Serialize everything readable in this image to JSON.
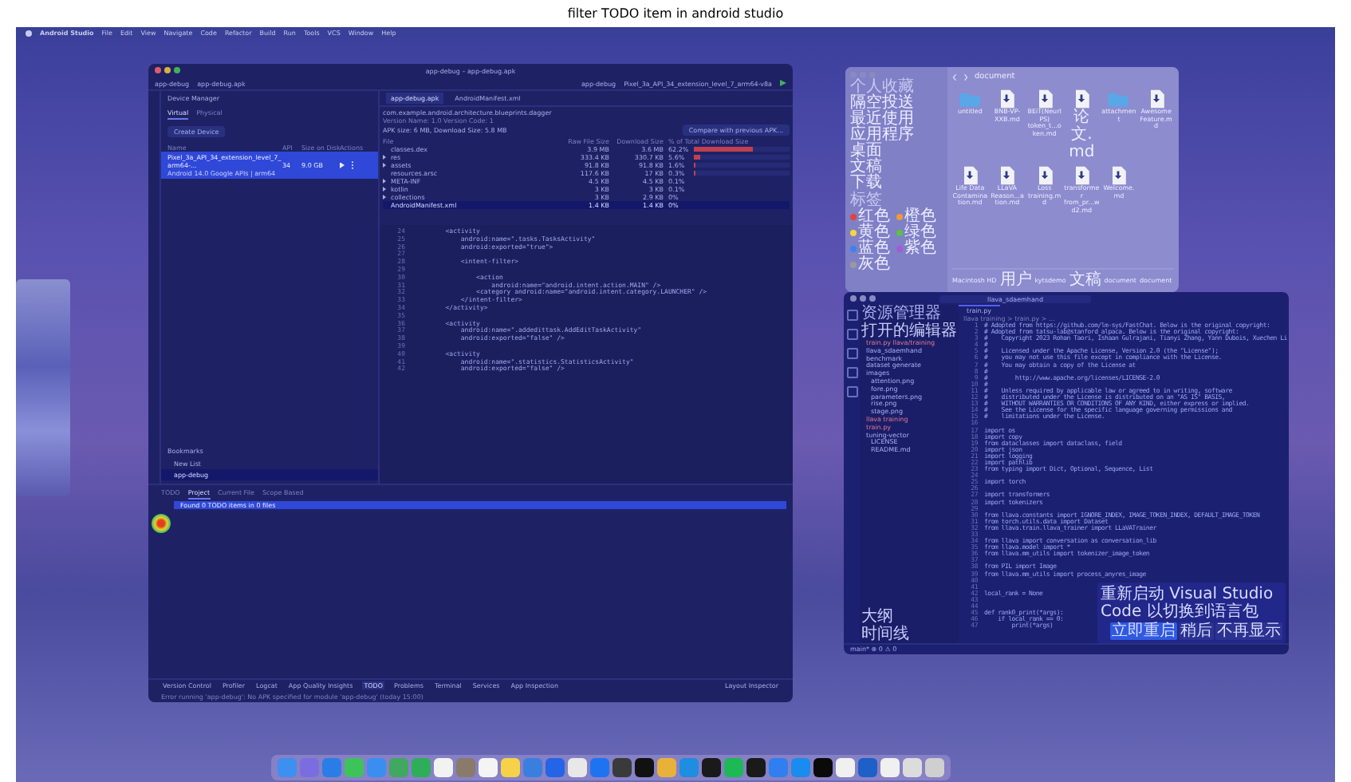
{
  "title": "filter TODO item in android studio",
  "menubar": {
    "app": "Android Studio",
    "items": [
      "File",
      "Edit",
      "View",
      "Navigate",
      "Code",
      "Refactor",
      "Build",
      "Run",
      "Tools",
      "VCS",
      "Window",
      "Help"
    ]
  },
  "android_studio": {
    "title": "app-debug – app-debug.apk",
    "project": "app-debug",
    "breadcrumb": "app-debug.apk",
    "run_config": "app-debug",
    "device": "Pixel_3a_API_34_extension_level_7_arm64-v8a",
    "device_manager": {
      "title": "Device Manager",
      "tabs": [
        {
          "label": "Virtual",
          "selected": true
        },
        {
          "label": "Physical",
          "selected": false
        }
      ],
      "create_button": "Create Device",
      "columns": [
        "Name",
        "API",
        "Size on Disk",
        "Actions"
      ],
      "devices": [
        {
          "name": "Pixel_3a_API_34_extension_level_7_arm64-...",
          "subtitle": "Android 14.0 Google APIs | arm64",
          "api": "34",
          "size": "9.0 GB",
          "selected": true
        }
      ]
    },
    "bookmarks": {
      "title": "Bookmarks",
      "items": [
        {
          "label": "New List",
          "selected": false
        },
        {
          "label": "app-debug",
          "selected": true
        }
      ]
    },
    "editor_tabs": [
      {
        "label": "app-debug.apk",
        "selected": true
      },
      {
        "label": "AndroidManifest.xml",
        "selected": false
      }
    ],
    "apk": {
      "package": "com.example.android.architecture.blueprints.dagger",
      "version": "Version Name: 1.0  Version Code: 1",
      "size_line": "APK size: 6 MB, Download Size: 5.8 MB",
      "compare_button": "Compare with previous APK...",
      "columns": [
        "File",
        "Raw File Size",
        "Download Size",
        "% of Total Download Size"
      ],
      "rows": [
        {
          "name": "classes.dex",
          "raw": "3.9 MB",
          "download": "3.6 MB",
          "percent": "62.2%",
          "level": 0.62,
          "expandable": false,
          "selected": false
        },
        {
          "name": "res",
          "raw": "333.4 KB",
          "download": "330.7 KB",
          "percent": "5.6%",
          "level": 0.06,
          "expandable": true,
          "selected": false
        },
        {
          "name": "assets",
          "raw": "91.8 KB",
          "download": "91.8 KB",
          "percent": "1.6%",
          "level": 0.02,
          "expandable": true,
          "selected": false
        },
        {
          "name": "resources.arsc",
          "raw": "117.6 KB",
          "download": "17 KB",
          "percent": "0.3%",
          "level": 0.01,
          "expandable": false,
          "selected": false
        },
        {
          "name": "META-INF",
          "raw": "4.5 KB",
          "download": "4.5 KB",
          "percent": "0.1%",
          "expandable": true,
          "selected": false
        },
        {
          "name": "kotlin",
          "raw": "3 KB",
          "download": "3 KB",
          "percent": "0.1%",
          "expandable": true,
          "selected": false
        },
        {
          "name": "collections",
          "raw": "3 KB",
          "download": "2.9 KB",
          "percent": "0%",
          "expandable": true,
          "selected": false
        },
        {
          "name": "AndroidManifest.xml",
          "raw": "1.4 KB",
          "download": "1.4 KB",
          "percent": "0%",
          "expandable": false,
          "selected": true
        }
      ]
    },
    "code": [
      {
        "n": "24",
        "text": "        <activity"
      },
      {
        "n": "25",
        "text": "            android:name=\".tasks.TasksActivity\""
      },
      {
        "n": "26",
        "text": "            android:exported=\"true\">"
      },
      {
        "n": "27"
      },
      {
        "n": "28",
        "text": "            <intent-filter>"
      },
      {
        "n": "29"
      },
      {
        "n": "30",
        "text": "                <action"
      },
      {
        "n": "31",
        "text": "                    android:name=\"android.intent.action.MAIN\" />"
      },
      {
        "n": "32",
        "text": "                <category android:name=\"android.intent.category.LAUNCHER\" />"
      },
      {
        "n": "33",
        "text": "            </intent-filter>"
      },
      {
        "n": "34",
        "text": "        </activity>"
      },
      {
        "n": "35"
      },
      {
        "n": "36",
        "text": "        <activity"
      },
      {
        "n": "37",
        "text": "            android:name=\".addedittask.AddEditTaskActivity\""
      },
      {
        "n": "38",
        "text": "            android:exported=\"false\" />"
      },
      {
        "n": "39"
      },
      {
        "n": "40",
        "text": "        <activity"
      },
      {
        "n": "41",
        "text": "            android:name=\".statistics.StatisticsActivity\""
      },
      {
        "n": "42",
        "text": "            android:exported=\"false\" />"
      }
    ],
    "todo": {
      "tabs": [
        {
          "label": "TODO",
          "selected": false
        },
        {
          "label": "Project",
          "selected": true
        },
        {
          "label": "Current File",
          "selected": false
        },
        {
          "label": "Scope Based",
          "selected": false
        }
      ],
      "result": "Found 0 TODO items in 0 files"
    },
    "tool_windows": [
      {
        "label": "Version Control",
        "selected": false
      },
      {
        "label": "Profiler",
        "selected": false
      },
      {
        "label": "Logcat",
        "selected": false
      },
      {
        "label": "App Quality Insights",
        "selected": false
      },
      {
        "label": "TODO",
        "selected": true
      },
      {
        "label": "Problems",
        "selected": false
      },
      {
        "label": "Terminal",
        "selected": false
      },
      {
        "label": "Services",
        "selected": false
      },
      {
        "label": "App Inspection",
        "selected": false
      }
    ],
    "layout_inspector": "Layout Inspector",
    "status": "Error running 'app-debug': No APK specified for module 'app-debug' (today 15:00)"
  },
  "finder": {
    "title": "document",
    "favorites_header": "个人收藏",
    "favorites": [
      "隔空投送",
      "最近使用",
      "应用程序",
      "桌面",
      "文稿",
      "下载"
    ],
    "tags_header": "标签",
    "tags": [
      {
        "label": "红色",
        "color": "#e0443e"
      },
      {
        "label": "橙色",
        "color": "#f09a37"
      },
      {
        "label": "黄色",
        "color": "#f5d63c"
      },
      {
        "label": "绿色",
        "color": "#5bc13f"
      },
      {
        "label": "蓝色",
        "color": "#3b82f0"
      },
      {
        "label": "紫色",
        "color": "#a55ad6"
      },
      {
        "label": "灰色",
        "color": "#9a9a9e"
      }
    ],
    "files": [
      {
        "name": "untitled",
        "kind": "folder"
      },
      {
        "name": "BNB-VP-XXB.md",
        "kind": "file"
      },
      {
        "name": "BEiT(NeurIPS) token_t...oken.md",
        "kind": "file"
      },
      {
        "name": "论文.md",
        "kind": "file"
      },
      {
        "name": "attachment",
        "kind": "folder"
      },
      {
        "name": "Awesome Feature.md",
        "kind": "file"
      },
      {
        "name": "Life Data Contamination.md",
        "kind": "file"
      },
      {
        "name": "LLaVA Reason...ation.md",
        "kind": "file"
      },
      {
        "name": "Loss training.md",
        "kind": "file"
      },
      {
        "name": "transformer from_pr...wd2.md",
        "kind": "file"
      },
      {
        "name": "Welcome.md",
        "kind": "file"
      }
    ],
    "path": [
      "Macintosh HD",
      "用户",
      "kytsdemo",
      "文稿",
      "document",
      "document"
    ]
  },
  "vscode": {
    "title": "llava_sdaemhand",
    "explorer": "资源管理器",
    "open_editors": "打开的编辑器",
    "open_file": "train.py  llava/training",
    "tree": [
      {
        "label": "llava_sdaemhand",
        "kind": "folder"
      },
      {
        "label": "benchmark",
        "kind": "folder"
      },
      {
        "label": "dataset generate",
        "kind": "folder"
      },
      {
        "label": "images",
        "kind": "folder"
      },
      {
        "label": "attention.png",
        "kind": "file"
      },
      {
        "label": "fore.png",
        "kind": "file"
      },
      {
        "label": "parameters.png",
        "kind": "file"
      },
      {
        "label": "rise.png",
        "kind": "file"
      },
      {
        "label": "stage.png",
        "kind": "file"
      },
      {
        "label": "llava training",
        "kind": "modified"
      },
      {
        "label": "train.py",
        "kind": "modified"
      },
      {
        "label": "tuning-vector",
        "kind": "folder"
      },
      {
        "label": "LICENSE",
        "kind": "file"
      },
      {
        "label": "README.md",
        "kind": "file"
      }
    ],
    "outline": "大纲",
    "timeline": "时间线",
    "tab": "train.py",
    "breadcrumb": "llava training > train.py > ...",
    "code": [
      {
        "n": "1",
        "text": "# Adopted from https://github.com/lm-sys/FastChat. Below is the original copyright:"
      },
      {
        "n": "2",
        "text": "# Adopted from tatsu-lab@stanford_alpaca. Below is the original copyright:"
      },
      {
        "n": "3",
        "text": "#    Copyright 2023 Rohan Taori, Ishaan Gulrajani, Tianyi Zhang, Yann Dubois, Xuechen Li"
      },
      {
        "n": "4",
        "text": "#"
      },
      {
        "n": "5",
        "text": "#    Licensed under the Apache License, Version 2.0 (the \"License\");"
      },
      {
        "n": "6",
        "text": "#    you may not use this file except in compliance with the License."
      },
      {
        "n": "7",
        "text": "#    You may obtain a copy of the License at"
      },
      {
        "n": "8",
        "text": "#"
      },
      {
        "n": "9",
        "text": "#        http://www.apache.org/licenses/LICENSE-2.0"
      },
      {
        "n": "10",
        "text": "#"
      },
      {
        "n": "11",
        "text": "#    Unless required by applicable law or agreed to in writing, software"
      },
      {
        "n": "12",
        "text": "#    distributed under the License is distributed on an \"AS IS\" BASIS,"
      },
      {
        "n": "13",
        "text": "#    WITHOUT WARRANTIES OR CONDITIONS OF ANY KIND, either express or implied."
      },
      {
        "n": "14",
        "text": "#    See the License for the specific language governing permissions and"
      },
      {
        "n": "15",
        "text": "#    limitations under the License."
      },
      {
        "n": "16"
      },
      {
        "n": "17",
        "text": "import os"
      },
      {
        "n": "18",
        "text": "import copy"
      },
      {
        "n": "19",
        "text": "from dataclasses import dataclass, field"
      },
      {
        "n": "20",
        "text": "import json"
      },
      {
        "n": "21",
        "text": "import logging"
      },
      {
        "n": "22",
        "text": "import pathlib"
      },
      {
        "n": "23",
        "text": "from typing import Dict, Optional, Sequence, List"
      },
      {
        "n": "24"
      },
      {
        "n": "25",
        "text": "import torch"
      },
      {
        "n": "26"
      },
      {
        "n": "27",
        "text": "import transformers"
      },
      {
        "n": "28",
        "text": "import tokenizers"
      },
      {
        "n": "29"
      },
      {
        "n": "30",
        "text": "from llava.constants import IGNORE_INDEX, IMAGE_TOKEN_INDEX, DEFAULT_IMAGE_TOKEN"
      },
      {
        "n": "31",
        "text": "from torch.utils.data import Dataset"
      },
      {
        "n": "32",
        "text": "from llava.train.llava_trainer import LLaVATrainer"
      },
      {
        "n": "33"
      },
      {
        "n": "34",
        "text": "from llava import conversation as conversation_lib"
      },
      {
        "n": "35",
        "text": "from llava.model import *"
      },
      {
        "n": "36",
        "text": "from llava.mm_utils import tokenizer_image_token"
      },
      {
        "n": "37"
      },
      {
        "n": "38",
        "text": "from PIL import Image"
      },
      {
        "n": "39",
        "text": "from llava.mm_utils import process_anyres_image"
      },
      {
        "n": "40"
      },
      {
        "n": "41"
      },
      {
        "n": "42",
        "text": "local_rank = None"
      },
      {
        "n": "43"
      },
      {
        "n": "44"
      },
      {
        "n": "45",
        "text": "def rank0_print(*args):"
      },
      {
        "n": "46",
        "text": "    if local_rank == 0:"
      },
      {
        "n": "47",
        "text": "        print(*args)"
      }
    ],
    "notification": {
      "text": "重新启动 Visual Studio Code 以切换到语言包",
      "buttons": [
        "立即重启",
        "稍后",
        "不再显示"
      ]
    },
    "status": "main*  ⊗ 0 ⚠ 0"
  },
  "dock": [
    {
      "color": "#3d8ff0"
    },
    {
      "color": "#7b6de0"
    },
    {
      "color": "#2a7de6"
    },
    {
      "color": "#3cc45a"
    },
    {
      "color": "#3a8ef0"
    },
    {
      "color": "#40a860"
    },
    {
      "color": "#2fae5a"
    },
    {
      "color": "#f2f2f2"
    },
    {
      "color": "#8a7a6a"
    },
    {
      "color": "#f4f4f4"
    },
    {
      "color": "#f5d24a"
    },
    {
      "color": "#3a7fe0"
    },
    {
      "color": "#2464e6"
    },
    {
      "color": "#e8e8e8"
    },
    {
      "color": "#1e74f0"
    },
    {
      "color": "#3a3a3a"
    },
    {
      "color": "#111111"
    },
    {
      "color": "#e8b23a"
    },
    {
      "color": "#1f8de0"
    },
    {
      "color": "#1a1a1a"
    },
    {
      "color": "#1db954"
    },
    {
      "color": "#1a1a1a"
    },
    {
      "color": "#2f7ff0"
    },
    {
      "color": "#1a8cf0"
    },
    {
      "color": "#0a0a0a"
    },
    {
      "color": "#f0f0f0"
    },
    {
      "color": "#1e5fc8"
    },
    {
      "color": "#f0f0f0"
    },
    {
      "color": "#dcdcdc"
    },
    {
      "color": "#cfcfcf"
    }
  ]
}
